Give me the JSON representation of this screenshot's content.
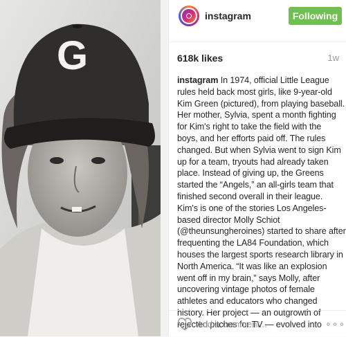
{
  "header": {
    "username": "instagram",
    "follow_label": "Following",
    "avatar_icon": "instagram-logo-icon"
  },
  "post": {
    "likes": "618k likes",
    "time": "1w",
    "caption_user": "instagram",
    "caption_lines": [
      "In 1974, official Little League",
      "rules held back most girls, like 9-year-old",
      "Kim Green (pictured), from playing baseball.",
      "Her mother, Sylvia, spent a month fighting",
      "for Kim's right to take the field with the",
      "boys, and her efforts paid off. The rules",
      "changed. But when Sylvia went to sign Kim",
      "up for a team, tryouts had already taken",
      "place. Instead of giving up, the Greens",
      "started the “Angels,” an all-girls team that",
      "finished second overall in their league.",
      "Kim's is one of the stories Los Angeles-",
      "based director Molly Schiot",
      "(@theunsungheroines) started to share after",
      "frequenting the LA84 Foundation, which",
      "houses the largest sports research library in",
      "North America. “It was like an explosion",
      "went off in my brain,” says Molly, after",
      "uncovering vintage photos of female",
      "athletes and educators who changed",
      "history. Her project — an outgrowth of",
      "rejected pitches for TV — evolved into"
    ],
    "photo_cap_letter": "G"
  },
  "comment": {
    "placeholder": "Add a comment...",
    "heart_icon": "heart-icon",
    "more_label": "∘∘∘"
  },
  "colors": {
    "follow_button": "#70c050",
    "muted_text": "#999999",
    "text": "#262626"
  }
}
